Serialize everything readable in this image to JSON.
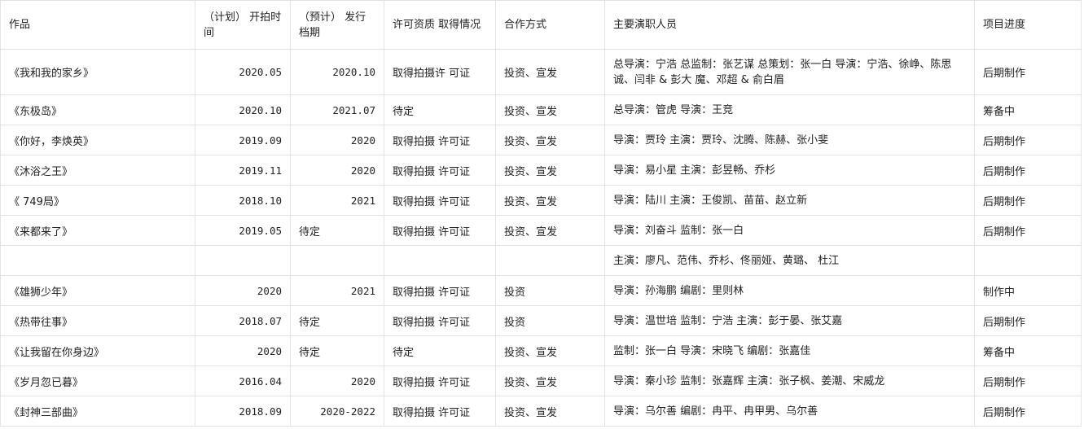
{
  "headers": [
    "作品",
    "（计划） 开拍时间",
    "（预计） 发行档期",
    "许可资质 取得情况",
    "合作方式",
    "主要演职人员",
    "项目进度"
  ],
  "rows": [
    {
      "work": "《我和我的家乡》",
      "start": "2020.05",
      "release": "2020.10",
      "license": "取得拍摄许 可证",
      "mode": "投资、宣发",
      "staff": "总导演：宁浩 总监制：张艺谋 总策划：张一白 导演：宁浩、徐峥、陈思诚、闫非 & 彭大 魔、邓超 & 俞白眉",
      "progress": "后期制作"
    },
    {
      "work": "《东极岛》",
      "start": "2020.10",
      "release": "2021.07",
      "license": "待定",
      "mode": "投资、宣发",
      "staff": "总导演：管虎 导演：王竞",
      "progress": "筹备中"
    },
    {
      "work": "《你好，李焕英》",
      "start": "2019.09",
      "release": "2020",
      "license": "取得拍摄 许可证",
      "mode": "投资、宣发",
      "staff": "导演：贾玲 主演：贾玲、沈腾、陈赫、张小斐",
      "progress": "后期制作"
    },
    {
      "work": "《沐浴之王》",
      "start": "2019.11",
      "release": "2020",
      "license": "取得拍摄 许可证",
      "mode": "投资、宣发",
      "staff": "导演：易小星 主演：彭昱畅、乔杉",
      "progress": "后期制作"
    },
    {
      "work": "《 749局》",
      "start": "2018.10",
      "release": "2021",
      "license": "取得拍摄 许可证",
      "mode": "投资、宣发",
      "staff": "导演：陆川 主演：王俊凯、苗苗、赵立新",
      "progress": "后期制作"
    },
    {
      "work": "《来都来了》",
      "start": "2019.05",
      "release": "待定",
      "license": "取得拍摄 许可证",
      "mode": "投资、宣发",
      "staff": "导演：刘奋斗 监制：张一白",
      "progress": "后期制作"
    },
    {
      "work": "",
      "start": "",
      "release": "",
      "license": "",
      "mode": "",
      "staff": "主演：廖凡、范伟、乔杉、佟丽娅、黄璐、 杜江",
      "progress": ""
    },
    {
      "work": "《雄狮少年》",
      "start": "2020",
      "release": "2021",
      "license": "取得拍摄 许可证",
      "mode": "投资",
      "staff": "导演：孙海鹏 编剧：里则林",
      "progress": "制作中"
    },
    {
      "work": "《热带往事》",
      "start": "2018.07",
      "release": "待定",
      "license": "取得拍摄 许可证",
      "mode": "投资",
      "staff": "导演：温世培 监制：宁浩 主演：彭于晏、张艾嘉",
      "progress": "后期制作"
    },
    {
      "work": "《让我留在你身边》",
      "start": "2020",
      "release": "待定",
      "license": "待定",
      "mode": "投资、宣发",
      "staff": "监制：张一白 导演：宋晓飞 编剧：张嘉佳",
      "progress": "筹备中"
    },
    {
      "work": "《岁月忽已暮》",
      "start": "2016.04",
      "release": "2020",
      "license": "取得拍摄 许可证",
      "mode": "投资、宣发",
      "staff": "导演：秦小珍 监制：张嘉辉 主演：张子枫、姜潮、宋威龙",
      "progress": "后期制作"
    },
    {
      "work": "《封神三部曲》",
      "start": "2018.09",
      "release": "2020-2022",
      "license": "取得拍摄 许可证",
      "mode": "投资、宣发",
      "staff": "导演：乌尔善 编剧：冉平、冉甲男、乌尔善",
      "progress": "后期制作"
    }
  ]
}
